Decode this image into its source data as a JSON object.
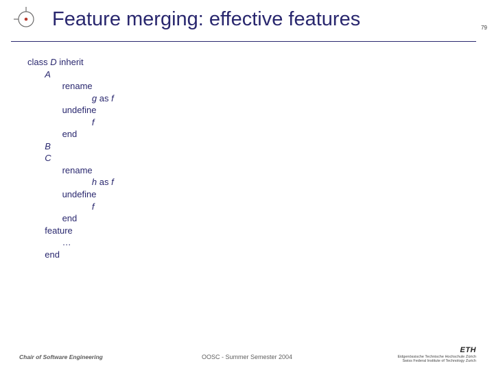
{
  "page_number": "79",
  "title": "Feature merging: effective features",
  "code": {
    "l1_a": "class ",
    "l1_b": "D",
    "l1_c": " inherit",
    "l2_a": "       ",
    "l2_b": "A",
    "l3": "              rename",
    "l4_a": "                          ",
    "l4_b": "g",
    "l4_c": " as ",
    "l4_d": "f",
    "l5": "              undefine",
    "l6_a": "                          ",
    "l6_b": "f",
    "l7": "              end",
    "l8_a": "       ",
    "l8_b": "B",
    "l9_a": "       ",
    "l9_b": "C",
    "l10": "              rename",
    "l11_a": "                          ",
    "l11_b": "h",
    "l11_c": " as ",
    "l11_d": "f",
    "l12": "              undefine",
    "l13_a": "                          ",
    "l13_b": "f",
    "l14": "              end",
    "l15": "       feature",
    "l16": "              …",
    "l17": "       end"
  },
  "footer": {
    "left": "Chair of Software Engineering",
    "center": "OOSC - Summer Semester 2004",
    "eth_main": "ETH",
    "eth_line1": "Eidgenössische Technische Hochschule Zürich",
    "eth_line2": "Swiss Federal Institute of Technology Zurich"
  }
}
